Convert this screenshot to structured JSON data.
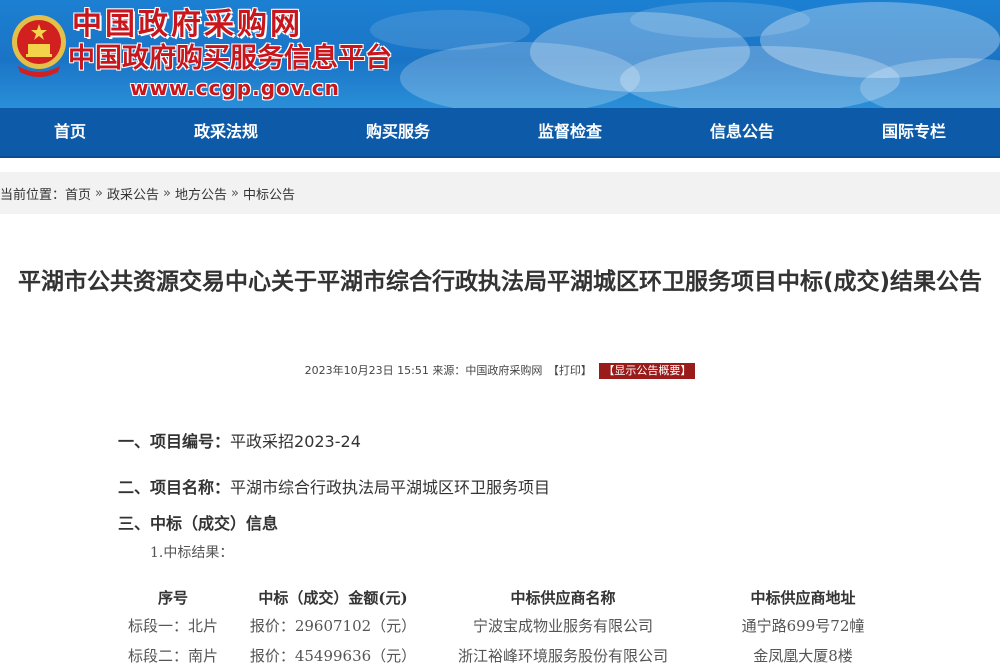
{
  "header": {
    "title": "中国政府采购网",
    "subtitle": "中国政府购买服务信息平台",
    "url": "www.ccgp.gov.cn"
  },
  "nav": {
    "items": [
      {
        "label": "首页"
      },
      {
        "label": "政采法规"
      },
      {
        "label": "购买服务"
      },
      {
        "label": "监督检查"
      },
      {
        "label": "信息公告"
      },
      {
        "label": "国际专栏"
      }
    ]
  },
  "breadcrumb": {
    "prefix": "当前位置：",
    "items": [
      "首页",
      "政采公告",
      "地方公告",
      "中标公告"
    ],
    "separator": "»"
  },
  "article": {
    "title": "平湖市公共资源交易中心关于平湖市综合行政执法局平湖城区环卫服务项目中标(成交)结果公告",
    "meta": {
      "datetime": "2023年10月23日 15:51",
      "source": "来源：中国政府采购网",
      "print_label": "【打印】",
      "overview_label": "【显示公告概要】"
    },
    "sections": [
      {
        "label": "一、项目编号：",
        "value": "平政采招2023-24"
      },
      {
        "label": "二、项目名称：",
        "value": "平湖市综合行政执法局平湖城区环卫服务项目"
      },
      {
        "label": "三、中标（成交）信息",
        "value": ""
      }
    ],
    "sub_label": "1.中标结果：",
    "table": {
      "headers": [
        "序号",
        "中标（成交）金额(元)",
        "中标供应商名称",
        "中标供应商地址"
      ],
      "rows": [
        [
          "标段一：北片",
          "报价：29607102（元）",
          "宁波宝成物业服务有限公司",
          "通宁路699号72幢"
        ],
        [
          "标段二：南片",
          "报价：45499636（元）",
          "浙江裕峰环境服务股份有限公司",
          "金凤凰大厦8楼"
        ]
      ]
    }
  },
  "colors": {
    "banner_blue": "#1a74c6",
    "nav_blue": "#0c5aa8",
    "brand_red": "#c8161d",
    "overview_bg": "#9b1b1b"
  }
}
